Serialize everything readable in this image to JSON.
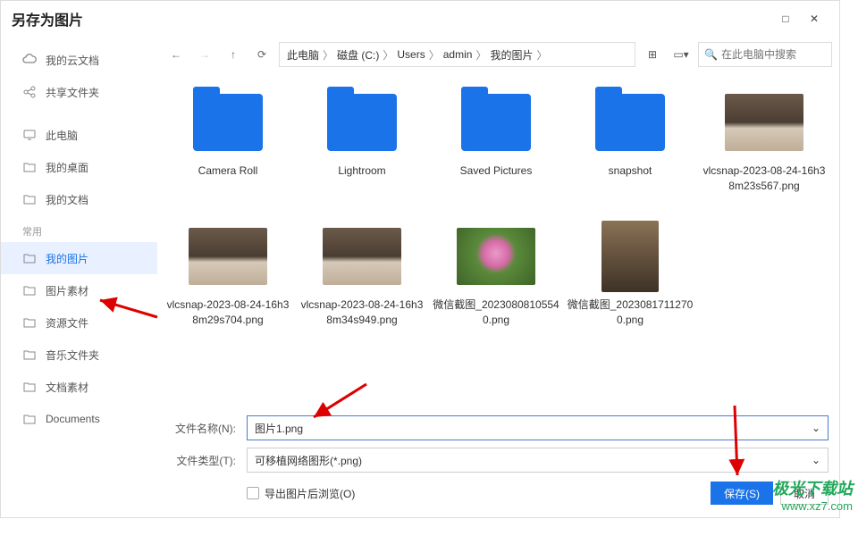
{
  "title": "另存为图片",
  "window_buttons": {
    "restore": "□",
    "close": "✕"
  },
  "sidebar": {
    "cloud": [
      {
        "icon": "cloud",
        "label": "我的云文档"
      },
      {
        "icon": "share",
        "label": "共享文件夹"
      }
    ],
    "local": [
      {
        "icon": "monitor",
        "label": "此电脑"
      },
      {
        "icon": "folder",
        "label": "我的桌面"
      },
      {
        "icon": "folder",
        "label": "我的文档"
      }
    ],
    "frequent_label": "常用",
    "frequent": [
      {
        "icon": "folder",
        "label": "我的图片",
        "selected": true
      },
      {
        "icon": "folder",
        "label": "图片素材"
      },
      {
        "icon": "folder",
        "label": "资源文件"
      },
      {
        "icon": "folder",
        "label": "音乐文件夹"
      },
      {
        "icon": "folder",
        "label": "文档素材"
      },
      {
        "icon": "folder",
        "label": "Documents"
      }
    ]
  },
  "breadcrumb": [
    "此电脑",
    "磁盘 (C:)",
    "Users",
    "admin",
    "我的图片"
  ],
  "search_placeholder": "在此电脑中搜索",
  "files": [
    {
      "type": "folder",
      "label": "Camera Roll"
    },
    {
      "type": "folder",
      "label": "Lightroom"
    },
    {
      "type": "folder",
      "label": "Saved Pictures"
    },
    {
      "type": "folder",
      "label": "snapshot"
    },
    {
      "type": "image",
      "thumb": "room",
      "label": "vlcsnap-2023-08-24-16h38m23s567.png"
    },
    {
      "type": "image",
      "thumb": "room",
      "label": "vlcsnap-2023-08-24-16h38m29s704.png"
    },
    {
      "type": "image",
      "thumb": "room",
      "label": "vlcsnap-2023-08-24-16h38m34s949.png"
    },
    {
      "type": "image",
      "thumb": "flower",
      "label": "微信截图_20230808105540.png"
    },
    {
      "type": "image",
      "thumb": "portrait",
      "label": "微信截图_20230817112700.png"
    }
  ],
  "filename_label": "文件名称(N):",
  "filename_value": "图片1.png",
  "filetype_label": "文件类型(T):",
  "filetype_value": "可移植网络图形(*.png)",
  "export_browse_label": "导出图片后浏览(O)",
  "save_btn": "保存(S)",
  "cancel_btn": "取消",
  "watermark": {
    "cn": "极光下载站",
    "url": "www.xz7.com"
  }
}
